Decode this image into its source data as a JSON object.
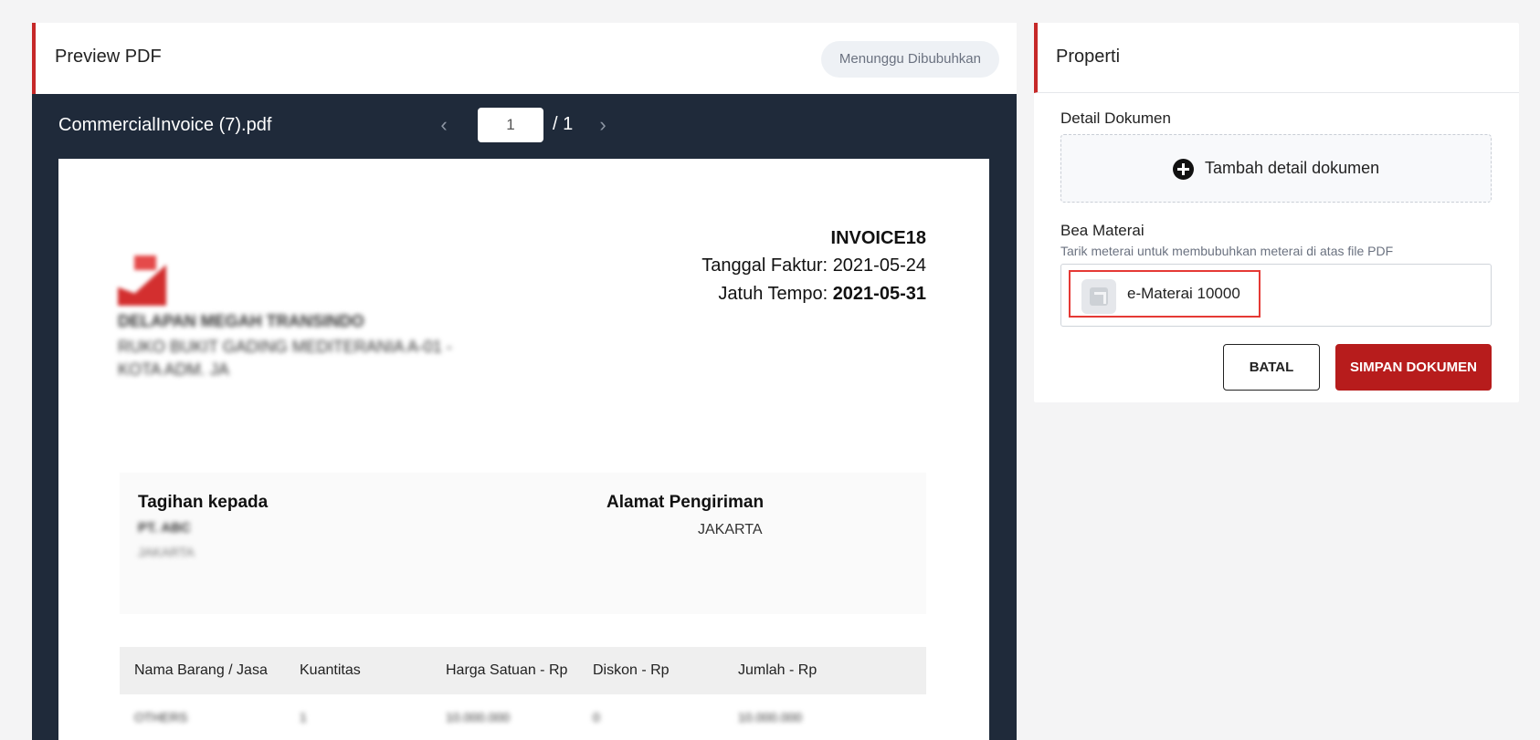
{
  "preview": {
    "title": "Preview PDF",
    "status": "Menunggu Dibubuhkan",
    "file_name": "CommercialInvoice (7).pdf",
    "page_current": "1",
    "page_total": "/ 1"
  },
  "invoice": {
    "number": "INVOICE18",
    "date_label": "Tanggal Faktur: ",
    "date_value": "2021-05-24",
    "due_label": "Jatuh Tempo: ",
    "due_value": "2021-05-31",
    "company_name": "DELAPAN MEGAH TRANSINDO",
    "company_address_line1": "RUKO BUKIT GADING MEDITERANIA A-01 -",
    "company_address_line2": "KOTA ADM. JA",
    "bill_to_title": "Tagihan kepada",
    "bill_to_name": "PT. ABC",
    "bill_to_city": "JAKARTA",
    "ship_to_title": "Alamat Pengiriman",
    "ship_to_city": "JAKARTA",
    "columns": [
      "Nama Barang / Jasa",
      "Kuantitas",
      "Harga Satuan - Rp",
      "Diskon - Rp",
      "Jumlah - Rp"
    ],
    "rows": [
      [
        "OTHERS",
        "1",
        "10.000.000",
        "0",
        "10.000.000"
      ]
    ]
  },
  "properties": {
    "title": "Properti",
    "detail_label": "Detail Dokumen",
    "add_detail_label": "Tambah detail dokumen",
    "stamp_label": "Bea Materai",
    "stamp_hint": "Tarik meterai untuk membubuhkan meterai di atas file PDF",
    "stamp_item": "e-Materai 10000",
    "cancel_label": "BATAL",
    "save_label": "SIMPAN DOKUMEN"
  },
  "colors": {
    "accent": "#c62828",
    "viewer_bg": "#1f2a3a",
    "save_button": "#b71c1c"
  },
  "icons": [
    "chevron-left-icon",
    "chevron-right-icon",
    "plus-circle-icon",
    "stamp-icon"
  ]
}
